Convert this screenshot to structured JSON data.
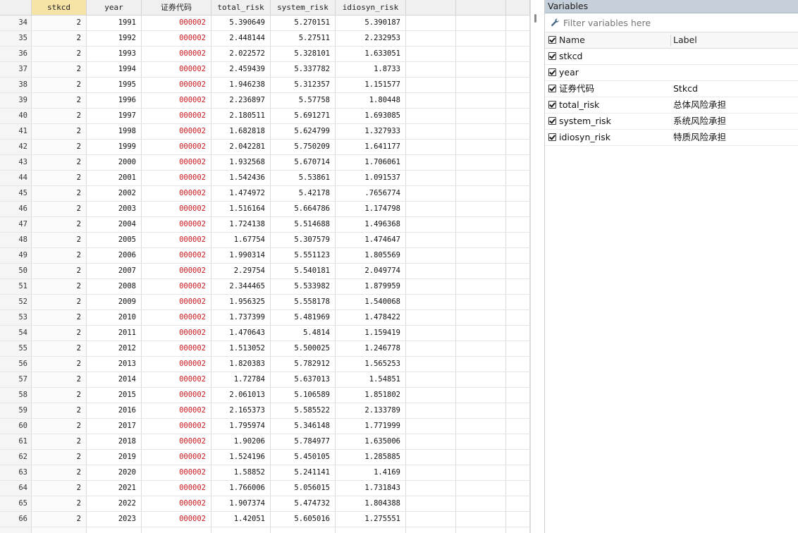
{
  "grid": {
    "columns": [
      "stkcd",
      "year",
      "证券代码",
      "total_risk",
      "system_risk",
      "idiosyn_risk"
    ],
    "selected_column": "stkcd",
    "rows": [
      {
        "n": "34",
        "stkcd": "2",
        "year": "1991",
        "code": "000002",
        "total": "5.390649",
        "system": "5.270151",
        "idio": "5.390187"
      },
      {
        "n": "35",
        "stkcd": "2",
        "year": "1992",
        "code": "000002",
        "total": "2.448144",
        "system": "5.27511",
        "idio": "2.232953"
      },
      {
        "n": "36",
        "stkcd": "2",
        "year": "1993",
        "code": "000002",
        "total": "2.022572",
        "system": "5.328101",
        "idio": "1.633051"
      },
      {
        "n": "37",
        "stkcd": "2",
        "year": "1994",
        "code": "000002",
        "total": "2.459439",
        "system": "5.337782",
        "idio": "1.8733"
      },
      {
        "n": "38",
        "stkcd": "2",
        "year": "1995",
        "code": "000002",
        "total": "1.946238",
        "system": "5.312357",
        "idio": "1.151577"
      },
      {
        "n": "39",
        "stkcd": "2",
        "year": "1996",
        "code": "000002",
        "total": "2.236897",
        "system": "5.57758",
        "idio": "1.80448"
      },
      {
        "n": "40",
        "stkcd": "2",
        "year": "1997",
        "code": "000002",
        "total": "2.180511",
        "system": "5.691271",
        "idio": "1.693085"
      },
      {
        "n": "41",
        "stkcd": "2",
        "year": "1998",
        "code": "000002",
        "total": "1.682818",
        "system": "5.624799",
        "idio": "1.327933"
      },
      {
        "n": "42",
        "stkcd": "2",
        "year": "1999",
        "code": "000002",
        "total": "2.042281",
        "system": "5.750209",
        "idio": "1.641177"
      },
      {
        "n": "43",
        "stkcd": "2",
        "year": "2000",
        "code": "000002",
        "total": "1.932568",
        "system": "5.670714",
        "idio": "1.706061"
      },
      {
        "n": "44",
        "stkcd": "2",
        "year": "2001",
        "code": "000002",
        "total": "1.542436",
        "system": "5.53861",
        "idio": "1.091537"
      },
      {
        "n": "45",
        "stkcd": "2",
        "year": "2002",
        "code": "000002",
        "total": "1.474972",
        "system": "5.42178",
        "idio": ".7656774"
      },
      {
        "n": "46",
        "stkcd": "2",
        "year": "2003",
        "code": "000002",
        "total": "1.516164",
        "system": "5.664786",
        "idio": "1.174798"
      },
      {
        "n": "47",
        "stkcd": "2",
        "year": "2004",
        "code": "000002",
        "total": "1.724138",
        "system": "5.514688",
        "idio": "1.496368"
      },
      {
        "n": "48",
        "stkcd": "2",
        "year": "2005",
        "code": "000002",
        "total": "1.67754",
        "system": "5.307579",
        "idio": "1.474647"
      },
      {
        "n": "49",
        "stkcd": "2",
        "year": "2006",
        "code": "000002",
        "total": "1.990314",
        "system": "5.551123",
        "idio": "1.805569"
      },
      {
        "n": "50",
        "stkcd": "2",
        "year": "2007",
        "code": "000002",
        "total": "2.29754",
        "system": "5.540181",
        "idio": "2.049774"
      },
      {
        "n": "51",
        "stkcd": "2",
        "year": "2008",
        "code": "000002",
        "total": "2.344465",
        "system": "5.533982",
        "idio": "1.879959"
      },
      {
        "n": "52",
        "stkcd": "2",
        "year": "2009",
        "code": "000002",
        "total": "1.956325",
        "system": "5.558178",
        "idio": "1.540068"
      },
      {
        "n": "53",
        "stkcd": "2",
        "year": "2010",
        "code": "000002",
        "total": "1.737399",
        "system": "5.481969",
        "idio": "1.478422"
      },
      {
        "n": "54",
        "stkcd": "2",
        "year": "2011",
        "code": "000002",
        "total": "1.470643",
        "system": "5.4814",
        "idio": "1.159419"
      },
      {
        "n": "55",
        "stkcd": "2",
        "year": "2012",
        "code": "000002",
        "total": "1.513052",
        "system": "5.500025",
        "idio": "1.246778"
      },
      {
        "n": "56",
        "stkcd": "2",
        "year": "2013",
        "code": "000002",
        "total": "1.820383",
        "system": "5.782912",
        "idio": "1.565253"
      },
      {
        "n": "57",
        "stkcd": "2",
        "year": "2014",
        "code": "000002",
        "total": "1.72784",
        "system": "5.637013",
        "idio": "1.54851"
      },
      {
        "n": "58",
        "stkcd": "2",
        "year": "2015",
        "code": "000002",
        "total": "2.061013",
        "system": "5.106589",
        "idio": "1.851802"
      },
      {
        "n": "59",
        "stkcd": "2",
        "year": "2016",
        "code": "000002",
        "total": "2.165373",
        "system": "5.585522",
        "idio": "2.133789"
      },
      {
        "n": "60",
        "stkcd": "2",
        "year": "2017",
        "code": "000002",
        "total": "1.795974",
        "system": "5.346148",
        "idio": "1.771999"
      },
      {
        "n": "61",
        "stkcd": "2",
        "year": "2018",
        "code": "000002",
        "total": "1.90206",
        "system": "5.784977",
        "idio": "1.635006"
      },
      {
        "n": "62",
        "stkcd": "2",
        "year": "2019",
        "code": "000002",
        "total": "1.524196",
        "system": "5.450105",
        "idio": "1.285885"
      },
      {
        "n": "63",
        "stkcd": "2",
        "year": "2020",
        "code": "000002",
        "total": "1.58852",
        "system": "5.241141",
        "idio": "1.4169"
      },
      {
        "n": "64",
        "stkcd": "2",
        "year": "2021",
        "code": "000002",
        "total": "1.766006",
        "system": "5.056015",
        "idio": "1.731843"
      },
      {
        "n": "65",
        "stkcd": "2",
        "year": "2022",
        "code": "000002",
        "total": "1.907374",
        "system": "5.474732",
        "idio": "1.804388"
      },
      {
        "n": "66",
        "stkcd": "2",
        "year": "2023",
        "code": "000002",
        "total": "1.42051",
        "system": "5.605016",
        "idio": "1.275551"
      }
    ]
  },
  "variables_panel": {
    "title": "Variables",
    "filter_placeholder": "Filter variables here",
    "name_header": "Name",
    "label_header": "Label",
    "variables": [
      {
        "name": "stkcd",
        "label": ""
      },
      {
        "name": "year",
        "label": ""
      },
      {
        "name": "证券代码",
        "label": "Stkcd"
      },
      {
        "name": "total_risk",
        "label": "总体风险承担"
      },
      {
        "name": "system_risk",
        "label": "系统风险承担"
      },
      {
        "name": "idiosyn_risk",
        "label": "特质风险承担"
      }
    ]
  },
  "icons": {
    "filter": "wrench-icon",
    "check": "checkbox-checked-icon"
  },
  "colors": {
    "string_value": "#c8191e",
    "selected_header": "#f6e3a6",
    "panel_title_bg": "#c6d0da"
  }
}
